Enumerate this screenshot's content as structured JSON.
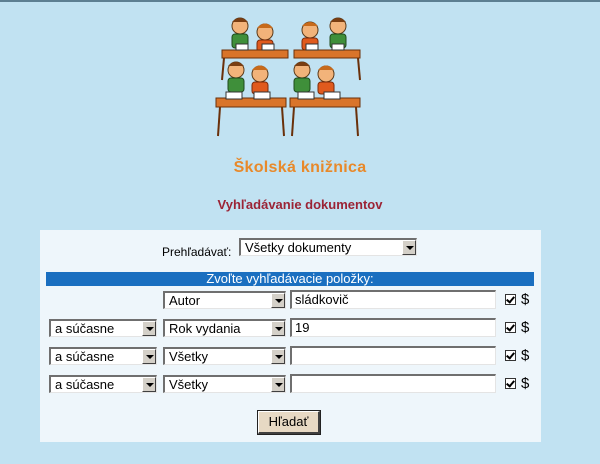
{
  "page": {
    "title": "Školská knižnica",
    "subtitle": "Vyhľadávanie dokumentov"
  },
  "search": {
    "browse_label": "Prehľadávať:",
    "browse_value": "Všetky dokumenty",
    "header": "Zvoľte vyhľadávacie položky:",
    "rows": [
      {
        "operator": "",
        "field": "Autor",
        "value": "sládkovič",
        "checked": true,
        "suffix": "$"
      },
      {
        "operator": "a súčasne",
        "field": "Rok vydania",
        "value": "19",
        "checked": true,
        "suffix": "$"
      },
      {
        "operator": "a súčasne",
        "field": "Všetky",
        "value": "",
        "checked": true,
        "suffix": "$"
      },
      {
        "operator": "a súčasne",
        "field": "Všetky",
        "value": "",
        "checked": true,
        "suffix": "$"
      }
    ],
    "submit_label": "Hľadať"
  }
}
